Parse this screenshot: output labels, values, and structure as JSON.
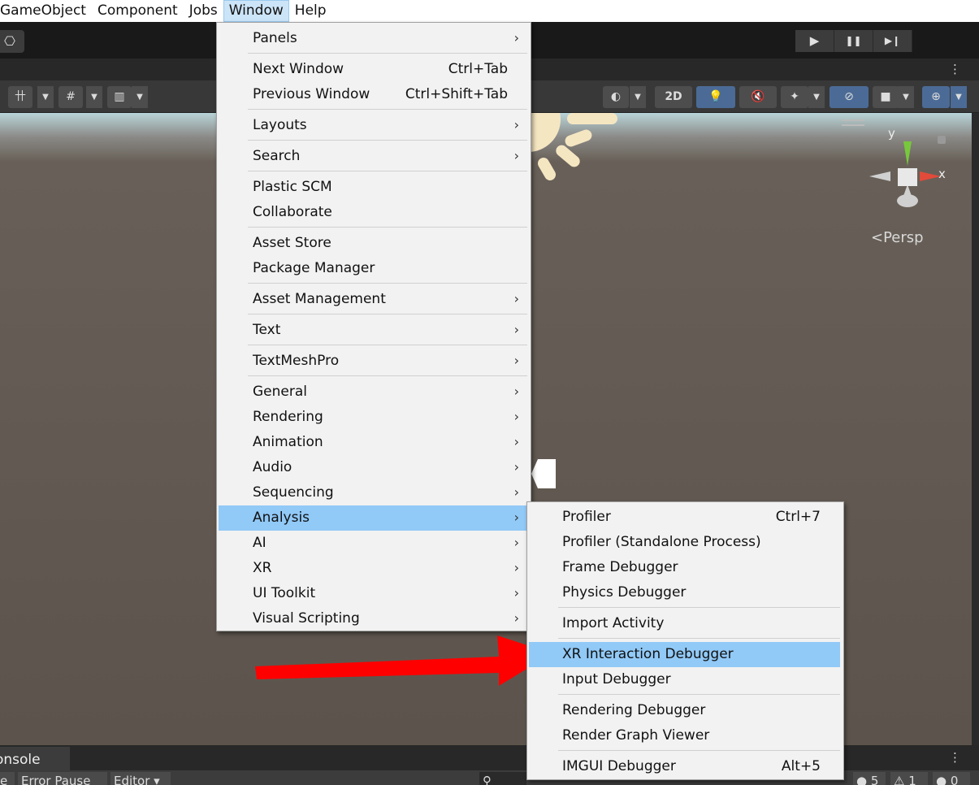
{
  "menubar": {
    "items": [
      "GameObject",
      "Component",
      "Jobs",
      "Window",
      "Help"
    ],
    "active": "Window"
  },
  "toolbar": {
    "play": "▶",
    "pause": "❚❚",
    "step": "▶❙"
  },
  "scene": {
    "mode_2d": "2D",
    "persp_label": "Persp",
    "gizmo_y": "y",
    "gizmo_x": "x"
  },
  "window_menu": {
    "items": [
      {
        "label": "Panels",
        "submenu": true
      },
      {
        "label": "Next Window",
        "shortcut": "Ctrl+Tab"
      },
      {
        "label": "Previous Window",
        "shortcut": "Ctrl+Shift+Tab"
      },
      {
        "label": "Layouts",
        "submenu": true
      },
      {
        "label": "Search",
        "submenu": true
      },
      {
        "label": "Plastic SCM"
      },
      {
        "label": "Collaborate"
      },
      {
        "label": "Asset Store"
      },
      {
        "label": "Package Manager"
      },
      {
        "label": "Asset Management",
        "submenu": true
      },
      {
        "label": "Text",
        "submenu": true
      },
      {
        "label": "TextMeshPro",
        "submenu": true
      },
      {
        "label": "General",
        "submenu": true
      },
      {
        "label": "Rendering",
        "submenu": true
      },
      {
        "label": "Animation",
        "submenu": true
      },
      {
        "label": "Audio",
        "submenu": true
      },
      {
        "label": "Sequencing",
        "submenu": true
      },
      {
        "label": "Analysis",
        "submenu": true,
        "highlighted": true
      },
      {
        "label": "AI",
        "submenu": true
      },
      {
        "label": "XR",
        "submenu": true
      },
      {
        "label": "UI Toolkit",
        "submenu": true
      },
      {
        "label": "Visual Scripting",
        "submenu": true
      }
    ]
  },
  "analysis_menu": {
    "items": [
      {
        "label": "Profiler",
        "shortcut": "Ctrl+7"
      },
      {
        "label": "Profiler (Standalone Process)"
      },
      {
        "label": "Frame Debugger"
      },
      {
        "label": "Physics Debugger"
      },
      {
        "label": "Import Activity"
      },
      {
        "label": "XR Interaction Debugger",
        "highlighted": true
      },
      {
        "label": "Input Debugger"
      },
      {
        "label": "Rendering Debugger"
      },
      {
        "label": "Render Graph Viewer"
      },
      {
        "label": "IMGUI Debugger",
        "shortcut": "Alt+5"
      }
    ]
  },
  "console": {
    "tab_label": "onsole",
    "toolbar_items": [
      "e",
      "Error Pause",
      "Editor ▾"
    ],
    "counts": [
      "5",
      "1",
      "0"
    ]
  },
  "colors": {
    "menu_highlight": "#91c9f7",
    "arrow": "#ff0000"
  }
}
